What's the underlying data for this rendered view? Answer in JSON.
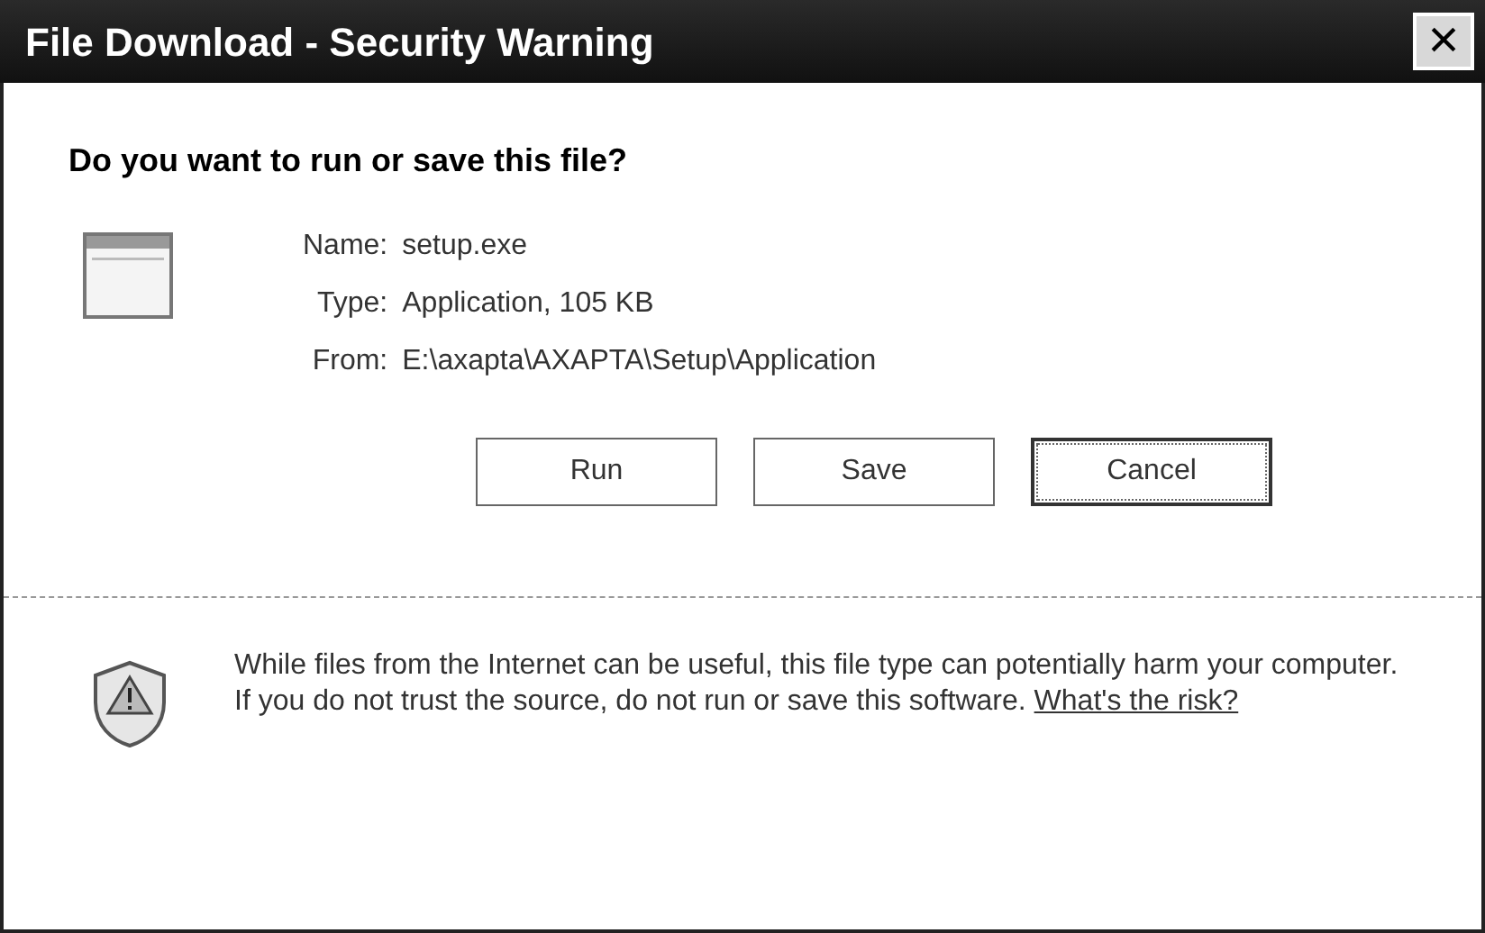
{
  "window": {
    "title": "File Download - Security Warning",
    "close": "×"
  },
  "heading": "Do you want to run or save this file?",
  "fields": [
    {
      "label": "Name:",
      "value": "setup.exe"
    },
    {
      "label": "Type:",
      "value": "Application, 105 KB"
    },
    {
      "label": "From:",
      "value": "E:\\axapta\\AXAPTA\\Setup\\Application"
    }
  ],
  "buttons": [
    {
      "label": "Run",
      "focused": false
    },
    {
      "label": "Save",
      "focused": false
    },
    {
      "label": "Cancel",
      "focused": true
    }
  ],
  "warning": {
    "text": "While files from the Internet can be useful, this file type can potentially harm your computer. If you do not trust the source, do not run or save this software.",
    "link": "What's the risk?"
  }
}
